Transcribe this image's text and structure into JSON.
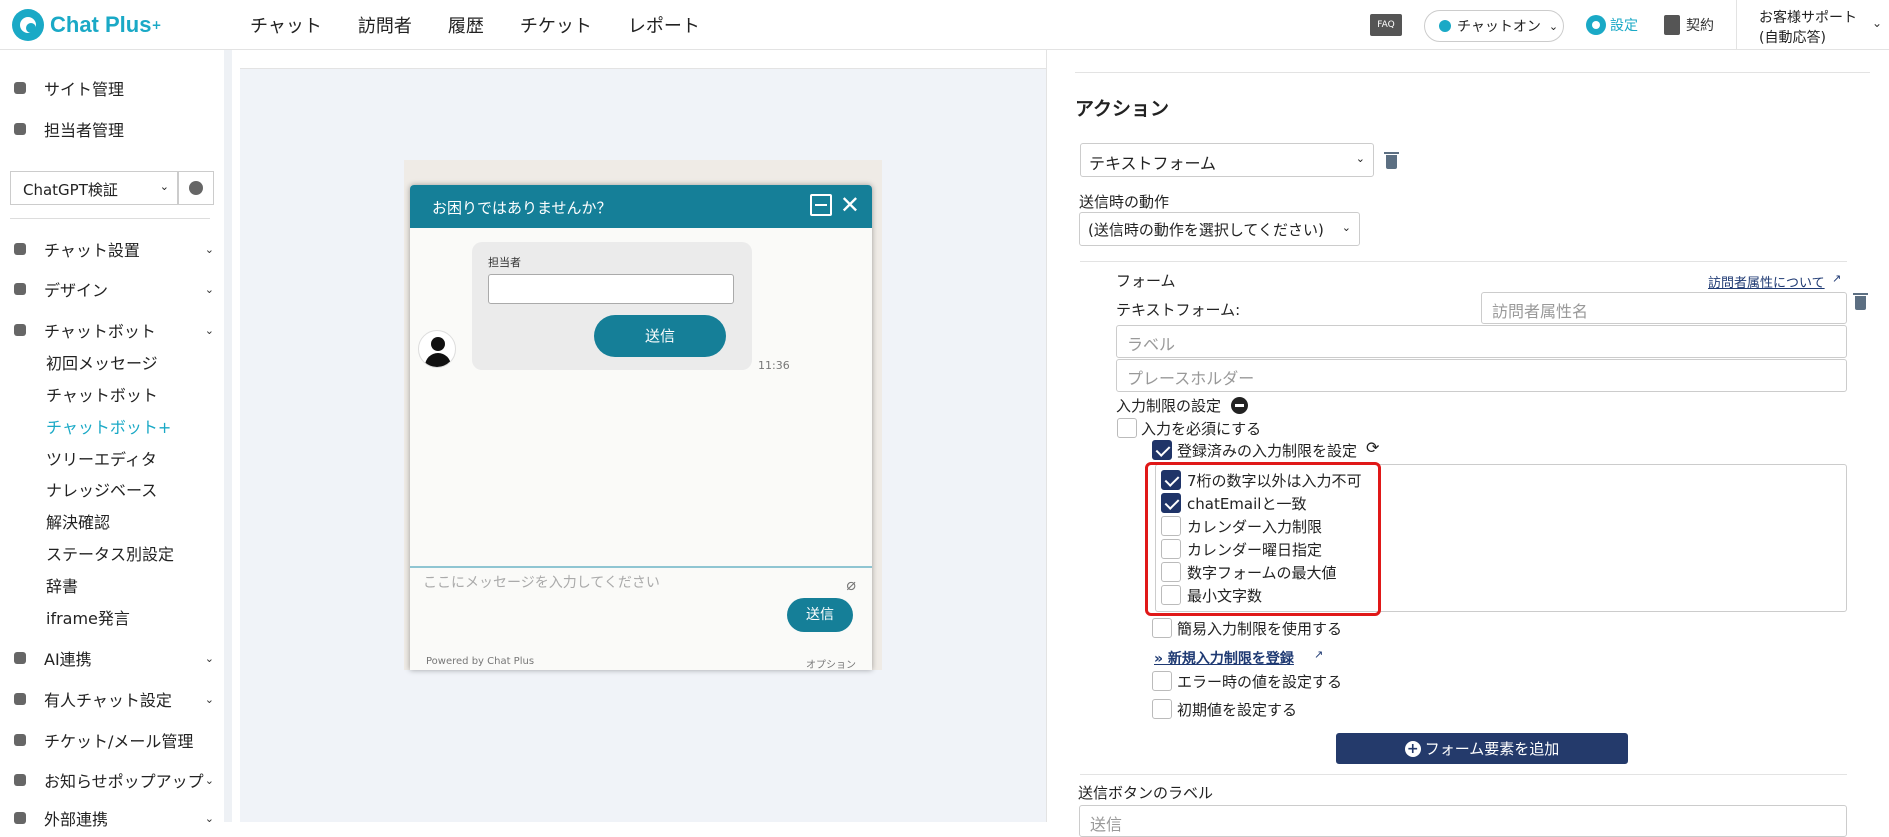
{
  "app": {
    "logo_text": "Chat Plus",
    "logo_sup": "+"
  },
  "topnav": [
    "チャット",
    "訪問者",
    "履歴",
    "チケット",
    "レポート"
  ],
  "header": {
    "faq": "FAQ",
    "chat_status": "チャットオン",
    "settings": "設定",
    "contract": "契約",
    "support_line1": "お客様サポート",
    "support_line2": "(自動応答)"
  },
  "sidebar": {
    "site_manage": "サイト管理",
    "staff_manage": "担当者管理",
    "site_select": "ChatGPT検証",
    "chat_settings": "チャット設置",
    "design": "デザイン",
    "chatbot": "チャットボット",
    "chatbot_sub": [
      "初回メッセージ",
      "チャットボット",
      "チャットボット+",
      "ツリーエディタ",
      "ナレッジベース",
      "解決確認",
      "ステータス別設定",
      "辞書",
      "iframe発言"
    ],
    "ai": "AI連携",
    "manned": "有人チャット設定",
    "ticket": "チケット/メール管理",
    "popup": "お知らせポップアップ",
    "external": "外部連携"
  },
  "widget": {
    "title": "お困りではありませんか？",
    "field_label": "担当者",
    "submit": "送信",
    "time": "11:36",
    "placeholder": "ここにメッセージを入力してください",
    "send": "送信",
    "powered": "Powered by Chat Plus",
    "option": "オプション"
  },
  "panel": {
    "title": "アクション",
    "action_select": "テキストフォーム",
    "on_submit_label": "送信時の動作",
    "on_submit_select": "(送信時の動作を選択してください)",
    "form_label": "フォーム",
    "visitor_attr_link": "訪問者属性について",
    "text_form_label": "テキストフォーム:",
    "visitor_attr_placeholder": "訪問者属性名",
    "label_placeholder": "ラベル",
    "placeholder_placeholder": "プレースホルダー",
    "input_limit_label": "入力制限の設定",
    "required_label": "入力を必須にする",
    "registered_limit_label": "登録済みの入力制限を設定",
    "limits": [
      {
        "label": "7桁の数字以外は入力不可",
        "checked": true
      },
      {
        "label": "chatEmailと一致",
        "checked": true
      },
      {
        "label": "カレンダー入力制限",
        "checked": false
      },
      {
        "label": "カレンダー曜日指定",
        "checked": false
      },
      {
        "label": "数字フォームの最大値",
        "checked": false
      },
      {
        "label": "最小文字数",
        "checked": false
      }
    ],
    "simple_limit_label": "簡易入力制限を使用する",
    "new_limit_link": "» 新規入力制限を登録",
    "error_value_label": "エラー時の値を設定する",
    "initial_value_label": "初期値を設定する",
    "add_form_button": "フォーム要素を追加",
    "submit_label_title": "送信ボタンのラベル",
    "submit_label_value": "送信"
  }
}
